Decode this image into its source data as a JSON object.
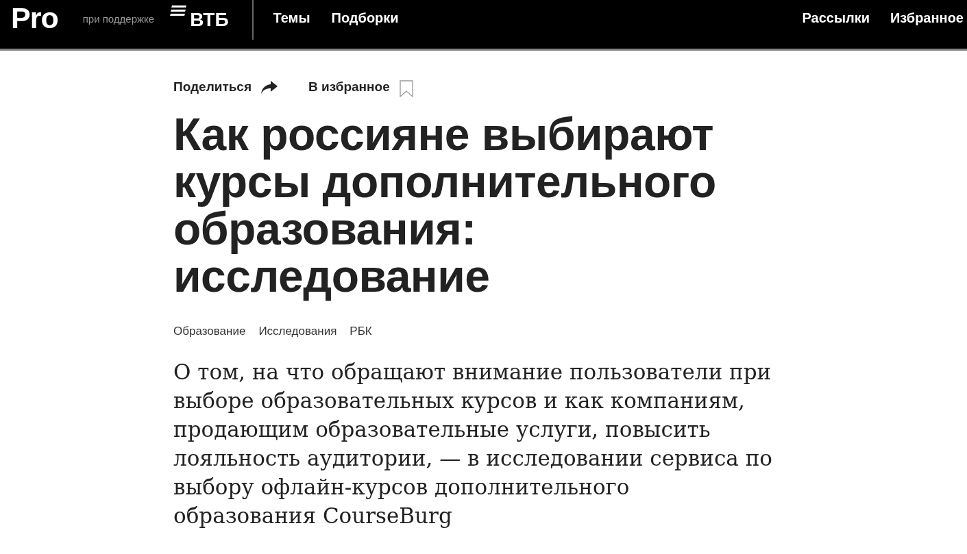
{
  "header": {
    "logo": "Pro",
    "sponsor_label": "при поддержке",
    "sponsor_logo": "ВТБ",
    "nav_left": [
      "Темы",
      "Подборки"
    ],
    "nav_right": [
      "Рассылки",
      "Избранное"
    ]
  },
  "actions": [
    {
      "label": "Поделиться",
      "kind": "share"
    },
    {
      "label": "В избранное",
      "kind": "bookmark"
    }
  ],
  "title": "Как россияне выбирают курсы дополнительного образования: исследование",
  "tags": [
    "Образование",
    "Исследования",
    "РБК"
  ],
  "lead": "О том, на что обращают внимание пользователи при выборе образовательных курсов и как компаниям, продающим образовательные услуги, повысить лояльность аудитории, — в исследовании сервиса по выбору офлайн-курсов дополнительного образования CourseBurg"
}
